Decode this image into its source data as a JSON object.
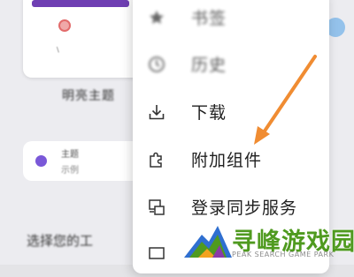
{
  "menu": {
    "items": [
      {
        "label": "书签",
        "icon": "star-icon"
      },
      {
        "label": "历史",
        "icon": "clock-icon"
      },
      {
        "label": "下载",
        "icon": "download-icon"
      },
      {
        "label": "附加组件",
        "icon": "puzzle-icon"
      },
      {
        "label": "登录同步服务",
        "icon": "sync-device-icon"
      },
      {
        "label": "",
        "icon": "device-icon"
      }
    ]
  },
  "background": {
    "card_tag": "\\",
    "heading": "明亮主题",
    "item_title": "主题",
    "item_subtitle": "示例",
    "section_title": "选择您的工"
  },
  "annotation": {
    "color": "#f08c32",
    "points_to": "附加组件"
  },
  "watermark": {
    "title": "寻峰游戏园",
    "subtitle": "PEAK SEARCH GAME PARK",
    "colors": {
      "green": "#4f9a1f",
      "blue": "#2f6fd0",
      "purple": "#8a3aa8",
      "orange": "#f2a21f"
    }
  }
}
